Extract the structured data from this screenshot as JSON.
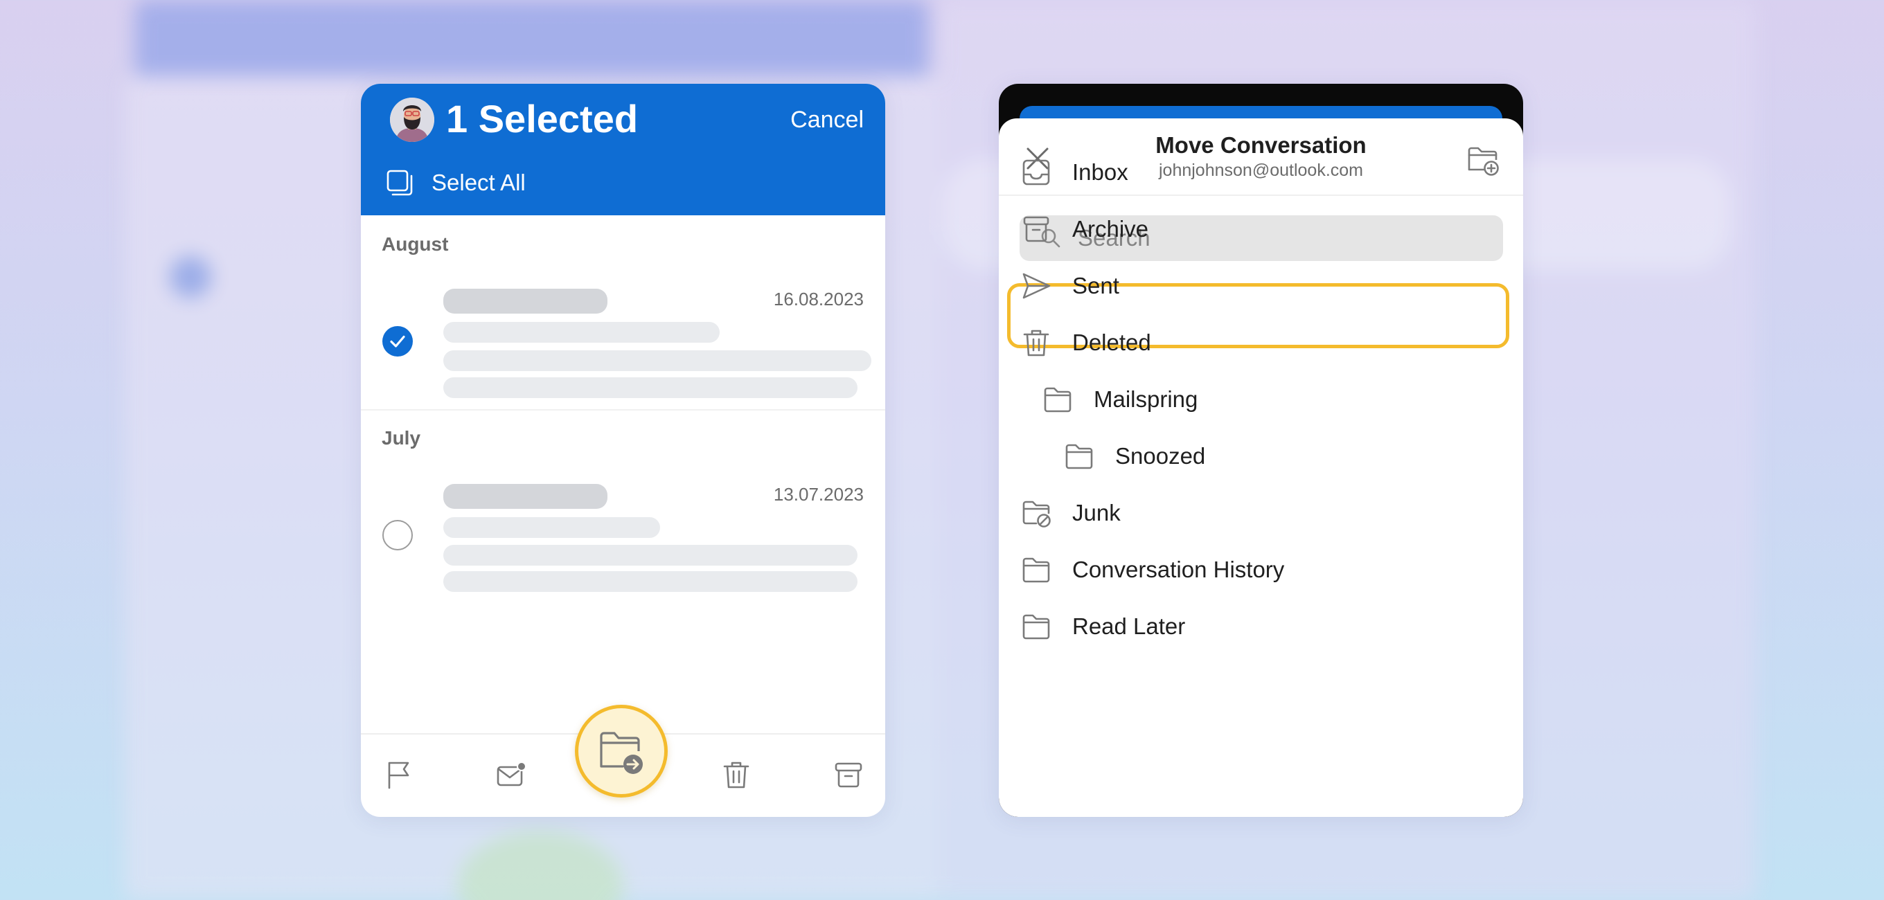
{
  "left_panel": {
    "header": {
      "title": "1 Selected",
      "cancel_label": "Cancel",
      "select_all_label": "Select All"
    },
    "groups": [
      {
        "label": "August",
        "message": {
          "date": "16.08.2023",
          "selected": true
        }
      },
      {
        "label": "July",
        "message": {
          "date": "13.07.2023",
          "selected": false
        }
      }
    ],
    "toolbar": {
      "items": [
        "flag-icon",
        "mail-unread-icon",
        "move-to-folder-icon",
        "trash-icon",
        "archive-icon"
      ],
      "highlighted": "move-to-folder-icon"
    }
  },
  "move_sheet": {
    "title": "Move Conversation",
    "account": "johnjohnson@outlook.com",
    "search_placeholder": "Search",
    "folders": [
      {
        "label": "Inbox",
        "icon": "inbox-icon",
        "highlighted": true
      },
      {
        "label": "Archive",
        "icon": "archive-icon"
      },
      {
        "label": "Sent",
        "icon": "send-icon"
      },
      {
        "label": "Deleted",
        "icon": "trash-icon"
      },
      {
        "label": "Mailspring",
        "icon": "folder-icon"
      },
      {
        "label": "Snoozed",
        "icon": "folder-icon"
      },
      {
        "label": "Junk",
        "icon": "junk-folder-icon"
      },
      {
        "label": "Conversation History",
        "icon": "folder-icon"
      },
      {
        "label": "Read Later",
        "icon": "folder-icon"
      }
    ]
  },
  "colors": {
    "brand_blue": "#0f6dd3",
    "highlight_yellow": "#f4bb2d",
    "highlight_fill": "#fdf3d3"
  }
}
